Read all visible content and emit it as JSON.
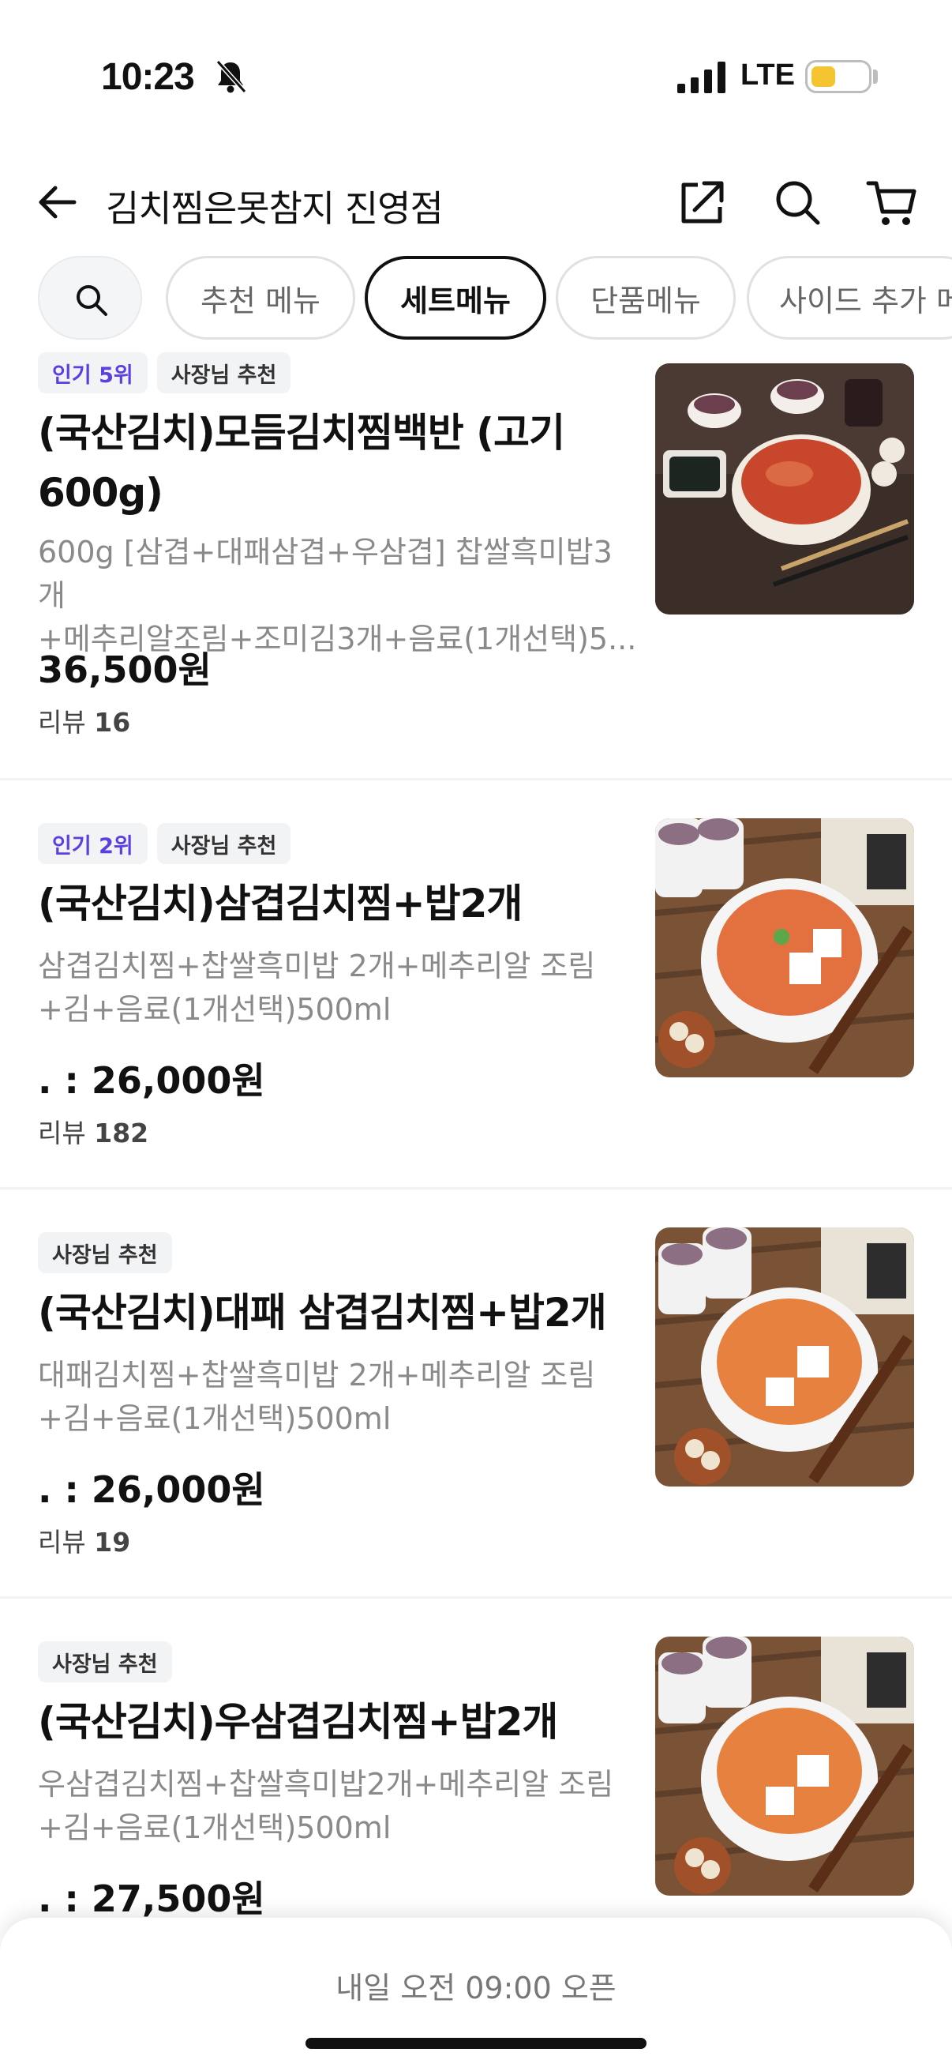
{
  "status_bar": {
    "time": "10:23",
    "network": "LTE"
  },
  "header": {
    "title": "김치찜은못참지 진영점"
  },
  "tabs": [
    {
      "label": "추천 메뉴",
      "active": false
    },
    {
      "label": "세트메뉴",
      "active": true
    },
    {
      "label": "단품메뉴",
      "active": false
    },
    {
      "label": "사이드 추가 메뉴",
      "active": false
    }
  ],
  "menu": [
    {
      "badges": [
        "인기 5위",
        "사장님 추천"
      ],
      "name_line1": "(국산김치)모듬김치찜백반 (고기",
      "name_line2": "600g)",
      "desc_line1": "600g [삼겹+대패삼겹+우삼겹] 찹쌀흑미밥3개",
      "desc_line2": "+메추리알조림+조미김3개+음료(1개선택)5...",
      "price": "36,500원",
      "review_label": "리뷰",
      "review_count": "16"
    },
    {
      "badges": [
        "인기 2위",
        "사장님 추천"
      ],
      "name_line1": "(국산김치)삼겹김치찜+밥2개",
      "desc_line1": "삼겹김치찜+찹쌀흑미밥 2개+메추리알 조림",
      "desc_line2": "+김+음료(1개선택)500ml",
      "price": ". : 26,000원",
      "review_label": "리뷰",
      "review_count": "182"
    },
    {
      "badges": [
        "사장님 추천"
      ],
      "name_line1": "(국산김치)대패 삼겹김치찜+밥2개",
      "desc_line1": "대패김치찜+찹쌀흑미밥 2개+메추리알 조림",
      "desc_line2": "+김+음료(1개선택)500ml",
      "price": ". : 26,000원",
      "review_label": "리뷰",
      "review_count": "19"
    },
    {
      "badges": [
        "사장님 추천"
      ],
      "name_line1": "(국산김치)우삼겹김치찜+밥2개",
      "desc_line1": "우삼겹김치찜+찹쌀흑미밥2개+메추리알 조림",
      "desc_line2": "+김+음료(1개선택)500ml",
      "price": ". : 27,500원"
    }
  ],
  "bottom_bar": {
    "notice": "내일 오전 09:00 오픈"
  },
  "colors": {
    "rank_badge": "#5b3fe0",
    "badge_bg": "#f2f3f5",
    "battery": "#f4c531"
  }
}
